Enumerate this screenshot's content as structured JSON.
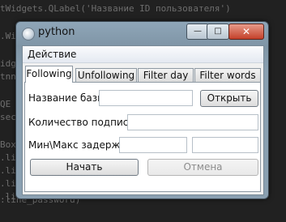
{
  "background_code": [
    "tWidgets.QLabel('Название ID пользователя')",
    ".Wi",
    "idge",
    "tnn",
    "QE",
    "secr",
    "Box",
    ".li",
    ".li",
    ".li",
    ".li",
    ".line_password)"
  ],
  "window": {
    "title": "python",
    "menu": "Действие",
    "controls": {
      "minimize": "—",
      "maximize": "□",
      "close": "✕"
    }
  },
  "tabs": [
    {
      "label": "Following",
      "active": true
    },
    {
      "label": "Unfollowing",
      "active": false
    },
    {
      "label": "Filter day",
      "active": false
    },
    {
      "label": "Filter words",
      "active": false
    }
  ],
  "form": {
    "db_label": "Название базы:",
    "db_value": "",
    "open_button": "Открыть",
    "subs_label": "Количество подписок:",
    "subs_value": "",
    "delay_label": "Мин\\Макс задержка:",
    "delay_min": "",
    "delay_max": "",
    "start_button": "Начать",
    "cancel_button": "Отмена"
  }
}
